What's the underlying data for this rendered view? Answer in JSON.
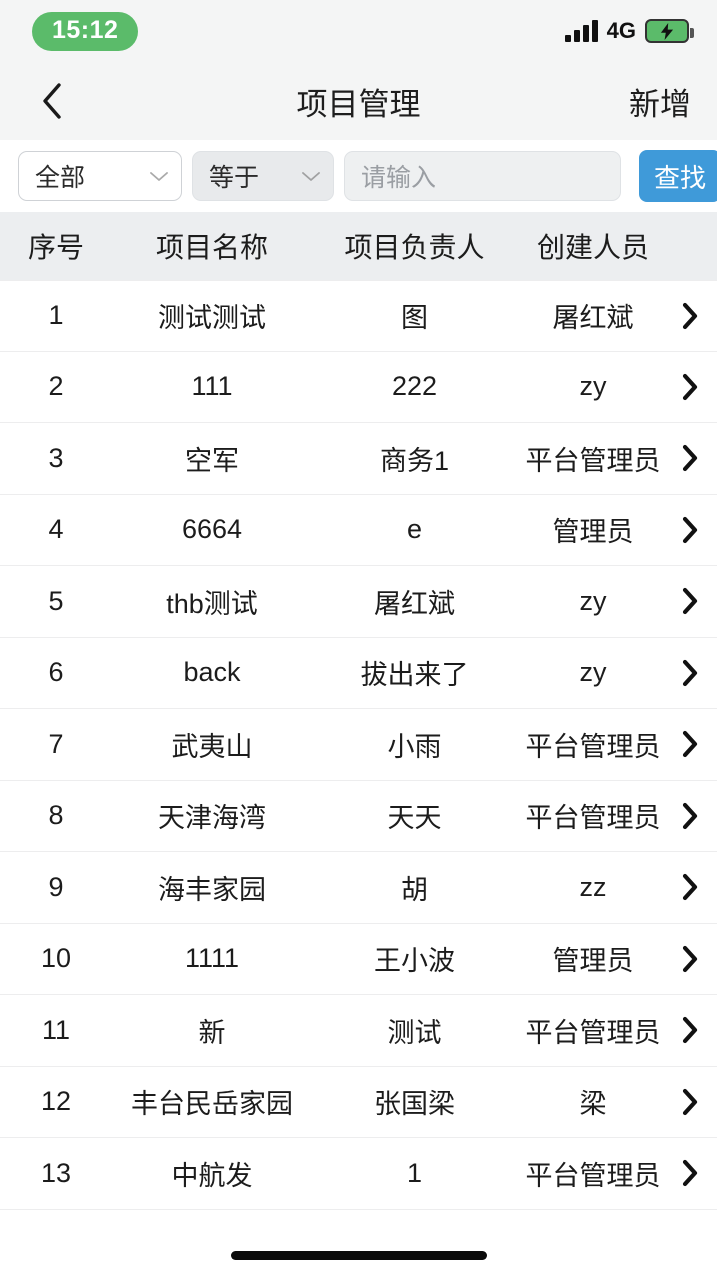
{
  "status_bar": {
    "time": "15:12",
    "network": "4G",
    "signal_icon": "signal-bars-icon",
    "battery_icon": "battery-charging-icon",
    "time_pill_color": "#5bbb6a"
  },
  "nav_bar": {
    "back_icon": "chevron-left-icon",
    "title": "项目管理",
    "action_label": "新增"
  },
  "filter_bar": {
    "scope_select": {
      "value": "全部",
      "icon": "chevron-down-icon"
    },
    "operator_select": {
      "value": "等于",
      "icon": "chevron-down-icon"
    },
    "keyword_input": {
      "value": "",
      "placeholder": "请输入"
    },
    "search_button": {
      "label": "查找",
      "color": "#3f9ad9"
    }
  },
  "table": {
    "columns": [
      "序号",
      "项目名称",
      "项目负责人",
      "创建人员"
    ],
    "row_arrow_icon": "chevron-right-icon",
    "rows": [
      {
        "index": "1",
        "name": "测试测试",
        "owner": "图",
        "creator": "屠红斌"
      },
      {
        "index": "2",
        "name": "111",
        "owner": "222",
        "creator": "zy"
      },
      {
        "index": "3",
        "name": "空军",
        "owner": "商务1",
        "creator": "平台管理员"
      },
      {
        "index": "4",
        "name": "6664",
        "owner": "e",
        "creator": "管理员"
      },
      {
        "index": "5",
        "name": "thb测试",
        "owner": "屠红斌",
        "creator": "zy"
      },
      {
        "index": "6",
        "name": "back",
        "owner": "拔出来了",
        "creator": "zy"
      },
      {
        "index": "7",
        "name": "武夷山",
        "owner": "小雨",
        "creator": "平台管理员"
      },
      {
        "index": "8",
        "name": "天津海湾",
        "owner": "天天",
        "creator": "平台管理员"
      },
      {
        "index": "9",
        "name": "海丰家园",
        "owner": "胡",
        "creator": "zz"
      },
      {
        "index": "10",
        "name": "1111",
        "owner": "王小波",
        "creator": "管理员"
      },
      {
        "index": "11",
        "name": "新",
        "owner": "测试",
        "creator": "平台管理员"
      },
      {
        "index": "12",
        "name": "丰台民岳家园",
        "owner": "张国梁",
        "creator": "梁"
      },
      {
        "index": "13",
        "name": "中航发",
        "owner": "1",
        "creator": "平台管理员"
      }
    ]
  },
  "home_indicator": {
    "label": "home-indicator"
  }
}
